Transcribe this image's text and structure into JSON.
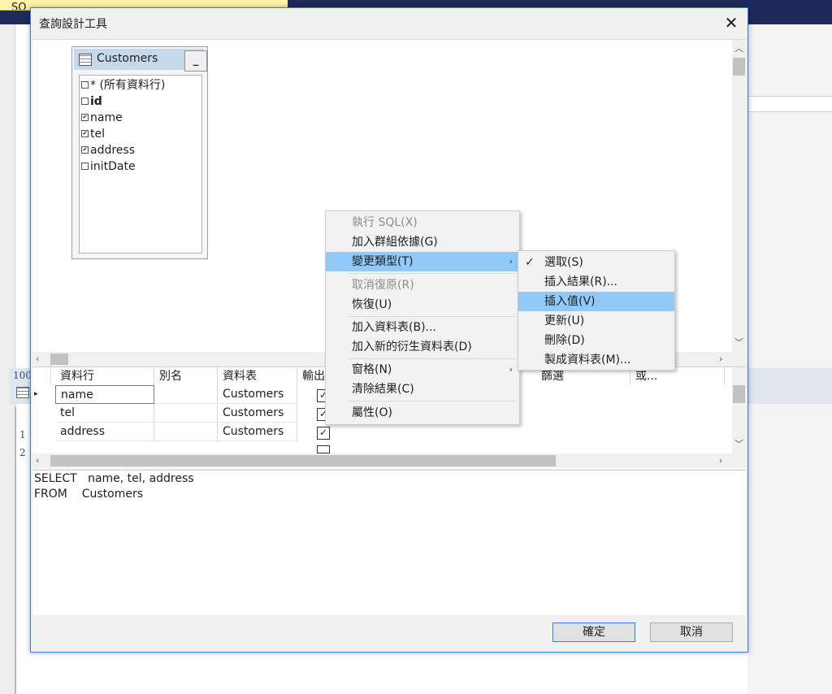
{
  "background": {
    "tab_label": "SQ",
    "gutter_numbers": [
      "100",
      "1",
      "2"
    ]
  },
  "dialog": {
    "title": "查詢設計工具",
    "close_glyph": "✕",
    "table_box": {
      "name": "Customers",
      "minimize_glyph": "_",
      "columns": [
        {
          "label": "* (所有資料行)",
          "checked": false,
          "bold": false
        },
        {
          "label": "id",
          "checked": false,
          "bold": true
        },
        {
          "label": "name",
          "checked": true,
          "bold": false
        },
        {
          "label": "tel",
          "checked": true,
          "bold": false
        },
        {
          "label": "address",
          "checked": true,
          "bold": false
        },
        {
          "label": "initDate",
          "checked": false,
          "bold": false
        }
      ]
    },
    "grid": {
      "headers": [
        "資料行",
        "別名",
        "資料表",
        "輸出",
        "篩選",
        "或..."
      ],
      "rows": [
        {
          "column": "name",
          "alias": "",
          "table": "Customers",
          "output": true
        },
        {
          "column": "tel",
          "alias": "",
          "table": "Customers",
          "output": true
        },
        {
          "column": "address",
          "alias": "",
          "table": "Customers",
          "output": true
        }
      ]
    },
    "sql": {
      "line1_keyword": "SELECT",
      "line1_rest": "name, tel, address",
      "line2_keyword": "FROM",
      "line2_rest": "Customers"
    },
    "ok_label": "確定",
    "cancel_label": "取消"
  },
  "context_menu": {
    "items": [
      {
        "label": "執行 SQL(X)",
        "disabled": true
      },
      {
        "label": "加入群組依據(G)",
        "disabled": false
      },
      {
        "label": "變更類型(T)",
        "disabled": false,
        "highlighted": true,
        "submenu": true
      },
      {
        "label": "取消復原(R)",
        "disabled": true
      },
      {
        "label": "恢復(U)",
        "disabled": false
      },
      {
        "label": "加入資料表(B)...",
        "disabled": false
      },
      {
        "label": "加入新的衍生資料表(D)",
        "disabled": false
      },
      {
        "label": "窗格(N)",
        "disabled": false,
        "submenu": true
      },
      {
        "label": "清除結果(C)",
        "disabled": false
      },
      {
        "label": "屬性(O)",
        "disabled": false
      }
    ],
    "submenu": {
      "items": [
        {
          "label": "選取(S)",
          "checked": true
        },
        {
          "label": "插入結果(R)...",
          "checked": false
        },
        {
          "label": "插入值(V)",
          "checked": false,
          "highlighted": true
        },
        {
          "label": "更新(U)",
          "checked": false
        },
        {
          "label": "刪除(D)",
          "checked": false
        },
        {
          "label": "製成資料表(M)...",
          "checked": false
        }
      ]
    }
  }
}
